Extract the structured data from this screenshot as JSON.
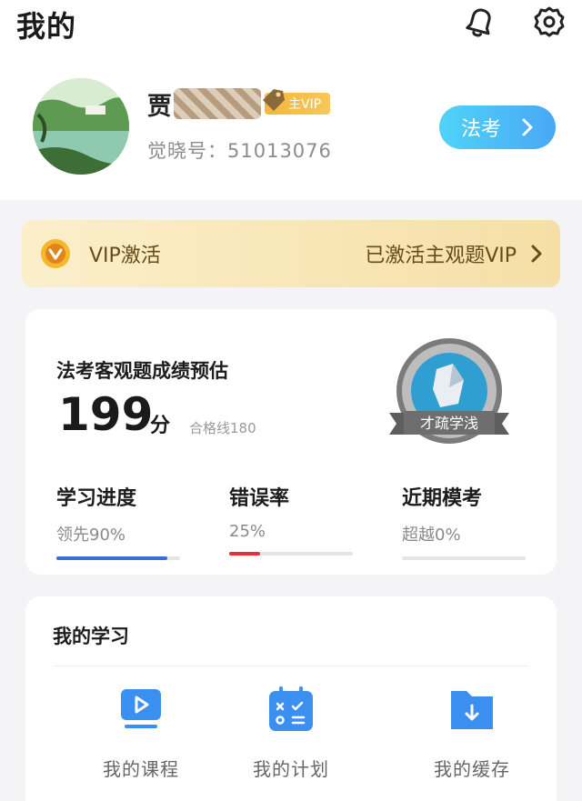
{
  "header": {
    "title": "我的",
    "icons": [
      "bell-icon",
      "gear-icon"
    ]
  },
  "profile": {
    "name_visible": "贾",
    "vip_badge": "主VIP",
    "user_id": "觉晓号：51013076",
    "exam_button": "法考"
  },
  "vip_bar": {
    "label": "VIP激活",
    "status": "已激活主观题VIP"
  },
  "score_card": {
    "title": "法考客观题成绩预估",
    "score": "199",
    "unit": "分",
    "pass_line": "合格线180",
    "badge_text": "才疏学浅",
    "stats": [
      {
        "label": "学习进度",
        "value": "领先90%",
        "progress": 0.9,
        "color": "#3a6fd8"
      },
      {
        "label": "错误率",
        "value": "25%",
        "progress": 0.25,
        "color": "#e0323e"
      },
      {
        "label": "近期模考",
        "value": "超越0%",
        "progress": 0,
        "color": "#3a6fd8"
      }
    ]
  },
  "study": {
    "title": "我的学习",
    "items": [
      {
        "label": "我的课程",
        "icon": "course-video-icon"
      },
      {
        "label": "我的计划",
        "icon": "plan-calendar-icon"
      },
      {
        "label": "我的缓存",
        "icon": "download-folder-icon"
      }
    ]
  },
  "colors": {
    "accent_blue": "#4aa8f5",
    "icon_blue": "#3b8ff0",
    "vip_gold": "#f5b63a",
    "error_red": "#e0323e"
  }
}
